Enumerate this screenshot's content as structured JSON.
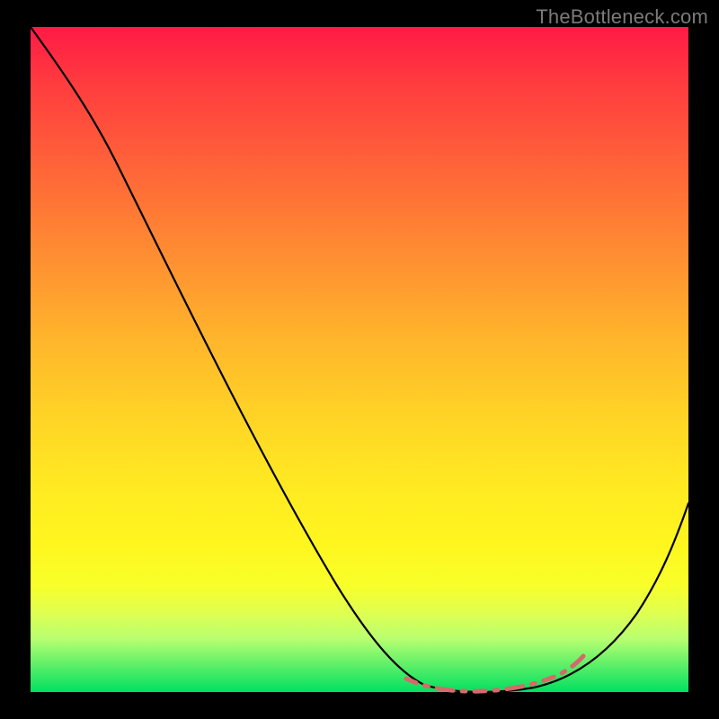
{
  "watermark": "TheBottleneck.com",
  "colors": {
    "background": "#000000",
    "gradient_top": "#ff1a45",
    "gradient_bottom": "#00e060",
    "highlight_dash": "#d46a6a",
    "curve": "#000000",
    "watermark_text": "#7a7a7a"
  },
  "chart_data": {
    "type": "line",
    "title": "",
    "xlabel": "",
    "ylabel": "",
    "x": [
      0,
      5,
      10,
      15,
      20,
      25,
      30,
      35,
      40,
      45,
      50,
      55,
      60,
      62,
      65,
      68,
      72,
      76,
      80,
      84,
      88,
      92,
      96,
      100
    ],
    "values": [
      100,
      94,
      87,
      80,
      72,
      62,
      52,
      42,
      32,
      22,
      14,
      8,
      3,
      1,
      0,
      0,
      0,
      0,
      1,
      3,
      8,
      15,
      24,
      34
    ],
    "xlim": [
      0,
      100
    ],
    "ylim": [
      0,
      100
    ],
    "highlight_range": {
      "x_start": 58,
      "x_end": 82,
      "label": "bottleneck-zone"
    },
    "background_fill": "rainbow-vertical-gradient"
  }
}
